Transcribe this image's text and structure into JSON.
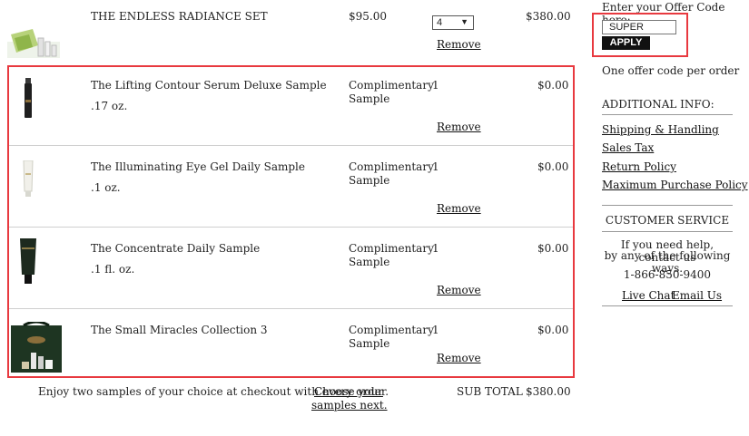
{
  "cart": {
    "top_item": {
      "name": "THE ENDLESS RADIANCE SET",
      "price": "$95.00",
      "qty": "4",
      "total": "$380.00",
      "remove": "Remove"
    },
    "samples": [
      {
        "name": "The Lifting Contour Serum Deluxe Sample",
        "size": ".17 oz.",
        "price_line1": "Complimentary",
        "price_line2": "Sample",
        "qty": "1",
        "total": "$0.00",
        "remove": "Remove"
      },
      {
        "name": "The Illuminating Eye Gel Daily Sample",
        "size": ".1 oz.",
        "price_line1": "Complimentary",
        "price_line2": "Sample",
        "qty": "1",
        "total": "$0.00",
        "remove": "Remove"
      },
      {
        "name": "The Concentrate Daily Sample",
        "size": ".1 fl. oz.",
        "price_line1": "Complimentary",
        "price_line2": "Sample",
        "qty": "1",
        "total": "$0.00",
        "remove": "Remove"
      },
      {
        "name": "The Small Miracles Collection 3",
        "size": "",
        "price_line1": "Complimentary",
        "price_line2": "Sample",
        "qty": "1",
        "total": "$0.00",
        "remove": "Remove"
      }
    ],
    "footer": {
      "note": "Enjoy two samples of your choice at checkout with every order.",
      "link_line1": "Choose your",
      "link_line2": "samples next.",
      "subtotal_label": "SUB TOTAL",
      "subtotal_value": "$380.00"
    }
  },
  "sidebar": {
    "offer_label": "Enter your Offer Code here:",
    "offer_value": "SUPER",
    "apply_label": "APPLY",
    "offer_note": "One offer code per order",
    "additional_title": "ADDITIONAL INFO:",
    "links": [
      "Shipping & Handling",
      "Sales Tax",
      "Return Policy",
      "Maximum Purchase Policy"
    ],
    "cs_title": "CUSTOMER SERVICE",
    "cs_help_line1": "If you need help, contact us",
    "cs_help_line2": "by any of the following ways.",
    "cs_phone": "1-866-850-9400",
    "cs_live_chat": "Live Chat",
    "cs_email": "Email Us"
  },
  "colors": {
    "highlight": "#e8393f",
    "apply_bg": "#111111"
  }
}
